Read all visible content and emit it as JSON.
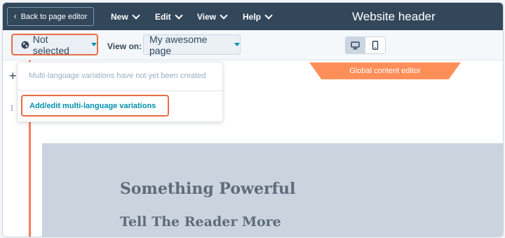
{
  "topbar": {
    "back_label": "Back to page editor",
    "menus": [
      {
        "label": "New"
      },
      {
        "label": "Edit"
      },
      {
        "label": "View"
      },
      {
        "label": "Help"
      }
    ],
    "title": "Website header"
  },
  "toolbar": {
    "language_label": "Not selected",
    "view_on_label": "View on:",
    "page_select_value": "My awesome page",
    "devices": [
      {
        "icon": "desktop-icon",
        "active": true
      },
      {
        "icon": "mobile-icon",
        "active": false
      }
    ]
  },
  "language_dropdown": {
    "info_text": "Multi-language variations have not yet been created",
    "action_label": "Add/edit multi-language variations"
  },
  "editor": {
    "global_tab_label": "Global content editor",
    "hero_title": "Something Powerful",
    "hero_subtitle": "Tell The Reader More"
  },
  "colors": {
    "topbar_bg": "#33475b",
    "accent_orange": "#ff7a59",
    "highlight_border": "#e76c47",
    "link_teal": "#0091ae",
    "hero_bg": "#cbd3df"
  }
}
